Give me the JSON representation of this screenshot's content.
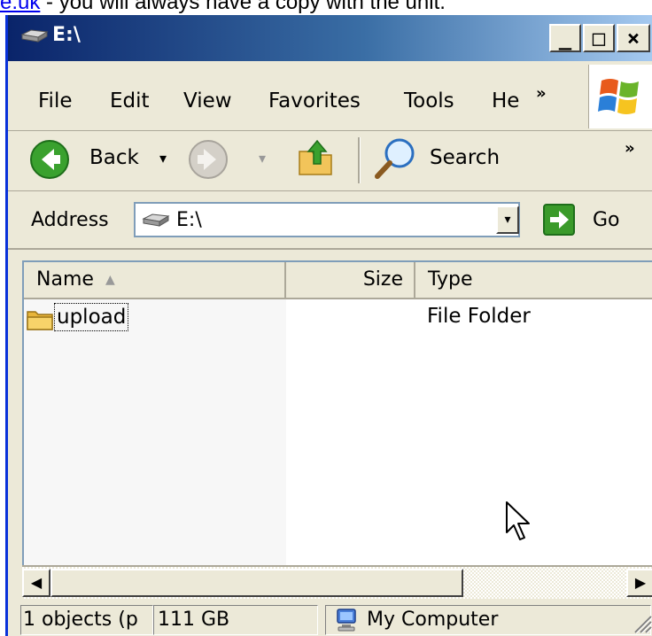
{
  "page_caption": {
    "link_fragment": "e.uk",
    "text": " - you will always have a copy with the unit."
  },
  "window": {
    "title": "E:\\",
    "caption_buttons": {
      "minimize": "_",
      "maximize": "□",
      "close": "×"
    }
  },
  "menu": {
    "items": [
      "File",
      "Edit",
      "View",
      "Favorites",
      "Tools",
      "He"
    ],
    "overflow": "»"
  },
  "toolbar": {
    "back_label": "Back",
    "dropdown_arrow": "▾",
    "search_label": "Search",
    "overflow": "»"
  },
  "address": {
    "label": "Address",
    "value": "E:\\",
    "go_label": "Go"
  },
  "listview": {
    "columns": [
      "Name",
      "Size",
      "Type"
    ],
    "sort_indicator": "▲",
    "rows": [
      {
        "name": "upload",
        "size": "",
        "type": "File Folder"
      }
    ]
  },
  "statusbar": {
    "objects": "1 objects (p",
    "free_space": "111 GB",
    "zone": "My Computer"
  },
  "colors": {
    "titlebar_start": "#0a246a",
    "titlebar_end": "#a6caf0",
    "go_green": "#3a9a2a",
    "face": "#ece9d8"
  }
}
